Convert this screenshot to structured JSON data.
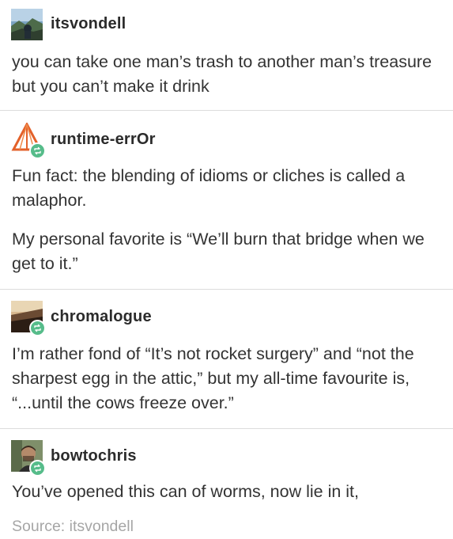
{
  "posts": [
    {
      "username": "itsvondell",
      "avatar_icon": "landscape-photo-avatar",
      "reblog": false,
      "paragraphs": [
        "you can take one man’s trash to another man’s treasure but you can’t make it drink"
      ]
    },
    {
      "username": "runtime-errOr",
      "avatar_icon": "orange-geometric-avatar",
      "reblog": true,
      "paragraphs": [
        "Fun fact: the blending of idioms or cliches is called a malaphor.",
        "My personal favorite is “We’ll burn that bridge when we get to it.”"
      ]
    },
    {
      "username": "chromalogue",
      "avatar_icon": "sunset-photo-avatar",
      "reblog": true,
      "paragraphs": [
        "I’m rather fond of “It’s not rocket surgery” and “not the sharpest egg in the attic,” but my all-time favourite is, “...until the cows freeze over.”"
      ]
    },
    {
      "username": "bowtochris",
      "avatar_icon": "person-photo-avatar",
      "reblog": true,
      "paragraphs": [
        "You’ve opened this can of worms, now lie in it,"
      ]
    }
  ],
  "source": "Source: itsvondell",
  "colors": {
    "text": "#333333",
    "username": "#2b2b2b",
    "reblog_badge": "#56bc8a",
    "source": "#a6a6a6",
    "divider": "#dcdcdc"
  }
}
